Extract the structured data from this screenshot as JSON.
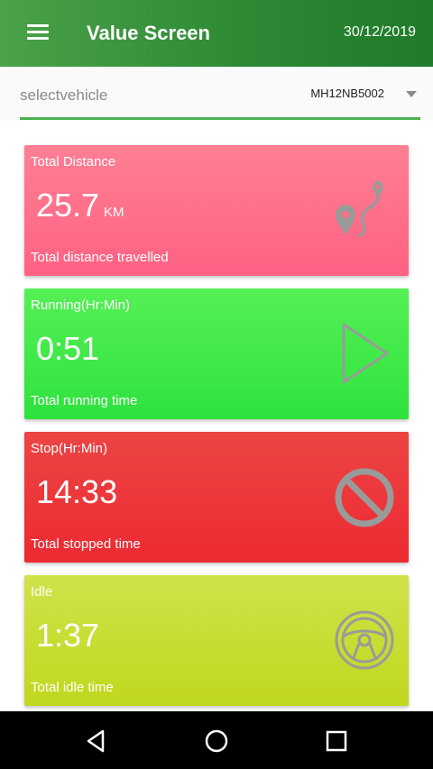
{
  "appbar": {
    "title": "Value Screen",
    "date": "30/12/2019",
    "menu_icon": "hamburger-menu-icon"
  },
  "vehicle": {
    "label": "selectvehicle",
    "selected": "MH12NB5002"
  },
  "cards": {
    "distance": {
      "title": "Total Distance",
      "value": "25.7",
      "unit": "KM",
      "subtitle": "Total distance travelled",
      "icon": "route-map-icon",
      "color": "#ff6f8b"
    },
    "running": {
      "title": "Running(Hr:Min)",
      "value": "0:51",
      "subtitle": "Total running time",
      "icon": "play-icon",
      "color": "#3fe94a"
    },
    "stop": {
      "title": "Stop(Hr:Min)",
      "value": "14:33",
      "subtitle": "Total stopped time",
      "icon": "stop-prohibited-icon",
      "color": "#ea3339"
    },
    "idle": {
      "title": "Idle",
      "value": "1:37",
      "subtitle": "Total idle time",
      "icon": "steering-wheel-icon",
      "color": "#c8dd35"
    }
  },
  "colors": {
    "appbar": "#2e8a35",
    "accent": "#4caf50"
  },
  "navbar": {
    "back_icon": "back-triangle-icon",
    "home_icon": "home-circle-icon",
    "recents_icon": "recents-square-icon"
  }
}
